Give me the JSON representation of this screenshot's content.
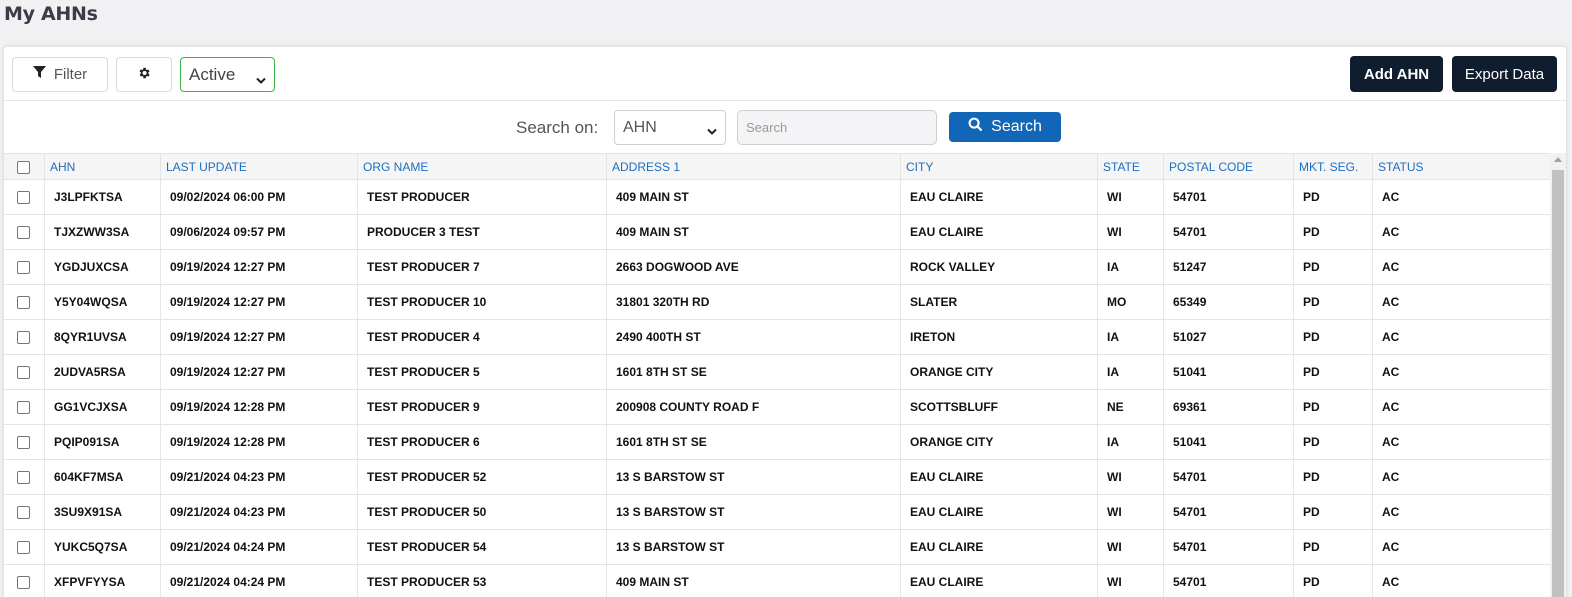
{
  "page": {
    "title": "My AHNs"
  },
  "toolbar": {
    "filter_label": "Filter",
    "filter_icon": "filter-icon",
    "settings_icon": "gear-icon",
    "status_value": "Active",
    "add_label": "Add AHN",
    "export_label": "Export Data"
  },
  "search": {
    "label": "Search on:",
    "field_value": "AHN",
    "placeholder": "Search",
    "button_label": "Search"
  },
  "table": {
    "columns": [
      "AHN",
      "LAST UPDATE",
      "ORG NAME",
      "ADDRESS 1",
      "CITY",
      "STATE",
      "POSTAL CODE",
      "MKT. SEG.",
      "STATUS"
    ],
    "rows": [
      [
        "J3LPFKTSA",
        "09/02/2024 06:00 PM",
        "TEST PRODUCER",
        "409 MAIN ST",
        "EAU CLAIRE",
        "WI",
        "54701",
        "PD",
        "AC"
      ],
      [
        "TJXZWW3SA",
        "09/06/2024 09:57 PM",
        "PRODUCER 3 TEST",
        "409 MAIN ST",
        "EAU CLAIRE",
        "WI",
        "54701",
        "PD",
        "AC"
      ],
      [
        "YGDJUXCSA",
        "09/19/2024 12:27 PM",
        "TEST PRODUCER 7",
        "2663 DOGWOOD AVE",
        "ROCK VALLEY",
        "IA",
        "51247",
        "PD",
        "AC"
      ],
      [
        "Y5Y04WQSA",
        "09/19/2024 12:27 PM",
        "TEST PRODUCER 10",
        "31801 320TH RD",
        "SLATER",
        "MO",
        "65349",
        "PD",
        "AC"
      ],
      [
        "8QYR1UVSA",
        "09/19/2024 12:27 PM",
        "TEST PRODUCER 4",
        "2490 400TH ST",
        "IRETON",
        "IA",
        "51027",
        "PD",
        "AC"
      ],
      [
        "2UDVA5RSA",
        "09/19/2024 12:27 PM",
        "TEST PRODUCER 5",
        "1601 8TH ST SE",
        "ORANGE CITY",
        "IA",
        "51041",
        "PD",
        "AC"
      ],
      [
        "GG1VCJXSA",
        "09/19/2024 12:28 PM",
        "TEST PRODUCER 9",
        "200908 COUNTY ROAD F",
        "SCOTTSBLUFF",
        "NE",
        "69361",
        "PD",
        "AC"
      ],
      [
        "PQIP091SA",
        "09/19/2024 12:28 PM",
        "TEST PRODUCER 6",
        "1601 8TH ST SE",
        "ORANGE CITY",
        "IA",
        "51041",
        "PD",
        "AC"
      ],
      [
        "604KF7MSA",
        "09/21/2024 04:23 PM",
        "TEST PRODUCER 52",
        "13 S BARSTOW ST",
        "EAU CLAIRE",
        "WI",
        "54701",
        "PD",
        "AC"
      ],
      [
        "3SU9X91SA",
        "09/21/2024 04:23 PM",
        "TEST PRODUCER 50",
        "13 S BARSTOW ST",
        "EAU CLAIRE",
        "WI",
        "54701",
        "PD",
        "AC"
      ],
      [
        "YUKC5Q7SA",
        "09/21/2024 04:24 PM",
        "TEST PRODUCER 54",
        "13 S BARSTOW ST",
        "EAU CLAIRE",
        "WI",
        "54701",
        "PD",
        "AC"
      ],
      [
        "XFPVFYYSA",
        "09/21/2024 04:24 PM",
        "TEST PRODUCER 53",
        "409 MAIN ST",
        "EAU CLAIRE",
        "WI",
        "54701",
        "PD",
        "AC"
      ]
    ]
  }
}
